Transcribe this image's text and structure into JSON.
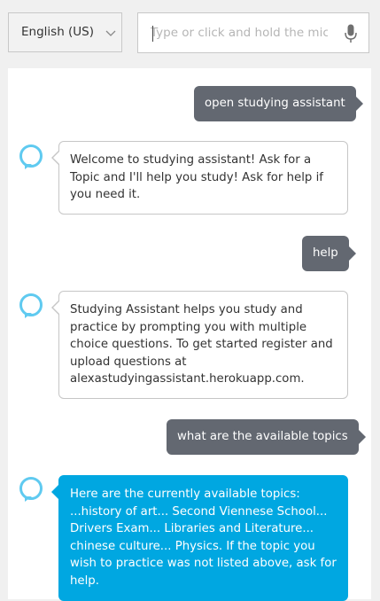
{
  "language_select": {
    "value": "English (US)"
  },
  "text_input": {
    "placeholder": "Type or click and hold the mic",
    "value": ""
  },
  "icons": {
    "language_dropdown": "chevron-down-icon",
    "mic": "microphone-icon",
    "assistant": "alexa-ring-icon"
  },
  "colors": {
    "user_bubble": "#636871",
    "assistant_active": "#00a7e1",
    "avatar_ring": "#5fcaf0"
  },
  "messages": [
    {
      "from": "user",
      "text": "open studying assistant"
    },
    {
      "from": "assistant",
      "text": "Welcome to studying assistant! Ask for a Topic and I'll help you study! Ask for help if you need it."
    },
    {
      "from": "user",
      "text": "help"
    },
    {
      "from": "assistant",
      "text": "Studying Assistant helps you study and practice by prompting you with multiple choice questions. To get started register and upload questions at alexastudyingassistant.herokuapp.com."
    },
    {
      "from": "user",
      "text": "what are the available topics"
    },
    {
      "from": "assistant",
      "text": "Here are the currently available topics: ...history of art... Second Viennese School... Drivers Exam... Libraries and Literature... chinese culture... Physics. If the topic you wish to practice was not listed above, ask for help."
    }
  ]
}
